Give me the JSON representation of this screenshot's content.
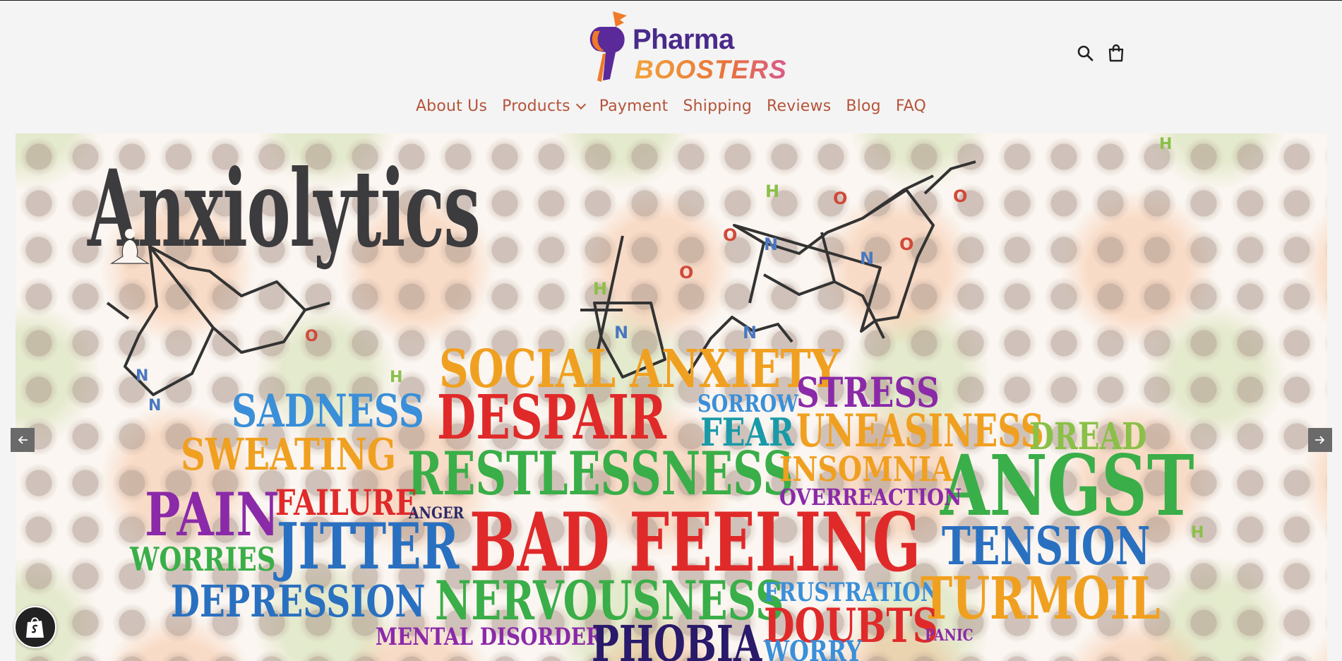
{
  "brand": {
    "name_line1": "Pharma",
    "name_line2": "BOOSTERS"
  },
  "header": {
    "icons": [
      "search-icon",
      "cart-icon"
    ]
  },
  "nav": {
    "items": [
      {
        "label": "About Us"
      },
      {
        "label": "Products",
        "has_dropdown": true
      },
      {
        "label": "Payment"
      },
      {
        "label": "Shipping"
      },
      {
        "label": "Reviews"
      },
      {
        "label": "Blog"
      },
      {
        "label": "FAQ"
      }
    ]
  },
  "banner": {
    "title": "Anxiolytics",
    "words": {
      "social_anxiety": "SOCIAL ANXIETY",
      "stress": "STRESS",
      "sadness": "SADNESS",
      "despair": "DESPAIR",
      "sorrow": "SORROW",
      "fear": "FEAR",
      "uneasiness": "UNEASINESS",
      "dread": "DREAD",
      "sweating": "SWEATING",
      "restlessness": "RESTLESSNESS",
      "insomnia": "INSOMNIA",
      "angst": "ANGST",
      "overreaction": "OVERREACTION",
      "pain": "PAIN",
      "failure": "FAILURE",
      "anger": "ANGER",
      "bad_feeling": "BAD FEELING",
      "tension": "TENSION",
      "worries": "WORRIES",
      "jitter": "JITTER",
      "depression": "DEPRESSION",
      "nervousness": "NERVOUSNESS",
      "frustration": "FRUSTRATION",
      "turmoil": "TURMOIL",
      "doubts": "DOUBTS",
      "mental_disorder": "MENTAL  DISORDER",
      "phobia": "PHOBIA",
      "worry": "WORRY",
      "panic": "PANIC"
    },
    "atoms": {
      "O": "O",
      "N": "N",
      "H": "H"
    }
  },
  "colors": {
    "nav_link": "#b5543a",
    "logo_purple": "#4a2a8a",
    "logo_orange": "#e8733a",
    "orange_word": "#f0a020",
    "red_word": "#e02a2a",
    "blue_word": "#3a8fd8",
    "green_word": "#3aae48",
    "purple_word": "#8a2aa8",
    "dark_blue_word": "#2a5aa8"
  }
}
